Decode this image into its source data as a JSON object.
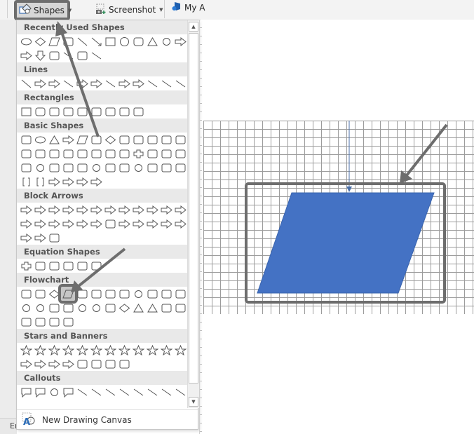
{
  "ribbon": {
    "shapes_label": "Shapes",
    "screenshot_label": "Screenshot",
    "myaddins_label": "My A"
  },
  "shapes_menu": {
    "categories": [
      {
        "label": "Recently Used Shapes",
        "rows": [
          [
            "oval",
            "diamond",
            "parallelogram",
            "note",
            "line",
            "arrow-line",
            "rectangle",
            "ellipse",
            "rounded-rectangle",
            "triangle",
            "elbow-connector",
            "elbow-arrow"
          ],
          [
            "right-arrow",
            "down-arrow",
            "snip-shape",
            "freeform-scribble",
            "arc",
            "wave-curve"
          ]
        ]
      },
      {
        "label": "Lines",
        "rows": [
          [
            "line",
            "arrow",
            "double-arrow",
            "elbow",
            "elbow-arrow",
            "elbow-double-arrow",
            "curve",
            "curved-arrow",
            "curved-double-arrow",
            "curve-free",
            "freeform",
            "scribble"
          ]
        ]
      },
      {
        "label": "Rectangles",
        "rows": [
          [
            "rectangle",
            "rounded-rectangle",
            "snip-single",
            "snip-same",
            "snip-diagonal",
            "snip-round",
            "round-single",
            "round-same",
            "round-diagonal"
          ]
        ]
      },
      {
        "label": "Basic Shapes",
        "rows": [
          [
            "text-box",
            "oval",
            "triangle",
            "right-triangle",
            "parallelogram",
            "trapezoid",
            "diamond",
            "pentagon",
            "hexagon",
            "heptagon-7",
            "octagon-8",
            "decagon-10"
          ],
          [
            "dodecagon-12",
            "pie",
            "chord",
            "teardrop",
            "frame",
            "half-frame",
            "l-shape",
            "diagonal-stripe",
            "cross",
            "plaque",
            "can",
            "cube"
          ],
          [
            "bevel",
            "donut",
            "no-symbol",
            "block-arc",
            "folded-corner",
            "smiley",
            "heart",
            "lightning",
            "sun",
            "moon",
            "cloud",
            "arc"
          ],
          [
            "double-bracket",
            "double-brace",
            "left-bracket",
            "right-bracket",
            "left-brace",
            "right-brace"
          ]
        ]
      },
      {
        "label": "Block Arrows",
        "rows": [
          [
            "right",
            "left",
            "up",
            "down",
            "left-right",
            "up-down",
            "quad",
            "left-right-up",
            "bent",
            "u-turn",
            "left-up",
            "bent-up"
          ],
          [
            "curved-right",
            "curved-left",
            "curved-up",
            "curved-down",
            "striped-right",
            "notched-right",
            "pentagon",
            "chevron",
            "right-callout",
            "down-callout",
            "left-callout",
            "up-callout"
          ],
          [
            "left-right-callout",
            "quad-callout",
            "circular"
          ]
        ]
      },
      {
        "label": "Equation Shapes",
        "rows": [
          [
            "plus",
            "minus",
            "multiply",
            "divide",
            "equal",
            "not-equal"
          ]
        ]
      },
      {
        "label": "Flowchart",
        "rows": [
          [
            "process",
            "alternate-process",
            "decision",
            "data",
            "predefined-process",
            "internal-storage",
            "document",
            "multidocument",
            "terminator",
            "preparation",
            "manual-input",
            "manual-operation"
          ],
          [
            "connector",
            "off-page-connector",
            "card",
            "punched-tape",
            "summing-junction",
            "or",
            "collate",
            "sort",
            "extract",
            "merge",
            "stored-data",
            "delay"
          ],
          [
            "sequential-access",
            "magnetic-disk",
            "direct-access",
            "display"
          ]
        ]
      },
      {
        "label": "Stars and Banners",
        "rows": [
          [
            "explosion-1",
            "explosion-2",
            "star-4",
            "star-5",
            "star-6",
            "star-7",
            "star-8",
            "star-10",
            "star-12",
            "star-16",
            "star-24",
            "star-32"
          ],
          [
            "ribbon-up",
            "ribbon-down",
            "curved-ribbon-up",
            "curved-ribbon-down",
            "vertical-scroll",
            "horizontal-scroll",
            "wave",
            "double-wave"
          ]
        ]
      },
      {
        "label": "Callouts",
        "rows": [
          [
            "rect-callout",
            "rounded-rect-callout",
            "oval-callout",
            "cloud-callout",
            "line-callout-1",
            "line-callout-2",
            "line-callout-3",
            "line-callout-1-accent",
            "line-callout-2-accent",
            "line-callout-3-accent",
            "line-callout-1-no-border",
            "line-callout-2-no-border"
          ]
        ]
      }
    ],
    "selected": {
      "category": "Flowchart",
      "shape": "data"
    },
    "footer_label": "New Drawing Canvas"
  },
  "statusbar": {
    "text": "Er"
  },
  "canvas": {
    "shape": "flowchart-data-parallelogram",
    "fill_color": "#4472c4",
    "highlight_color": "#6d6d6d"
  }
}
